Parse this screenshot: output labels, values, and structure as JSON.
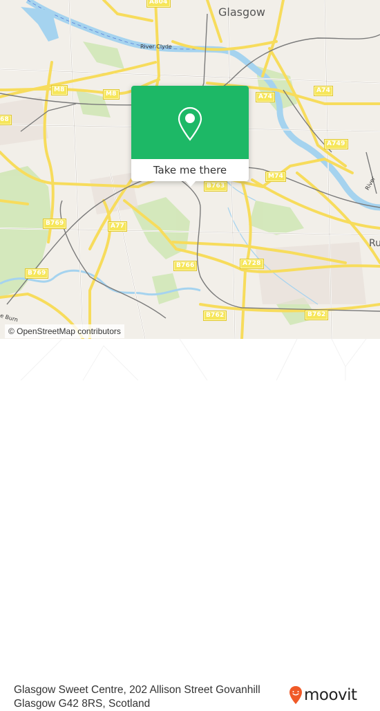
{
  "map": {
    "city_label": "Glasgow",
    "partial_label": "Ru",
    "rivers": [
      "River Clyde",
      "River"
    ],
    "water_label": "e Burn",
    "road_shields": [
      "A804",
      "M8",
      "M8",
      "A74",
      "A74",
      "A749",
      "M74",
      "B763",
      "B769",
      "A77",
      "B769",
      "B766",
      "A728",
      "B762",
      "B762",
      "68"
    ],
    "attribution": "© OpenStreetMap contributors"
  },
  "popup": {
    "icon": "location-pin-icon",
    "button_label": "Take me there",
    "accent_color": "#1db866"
  },
  "footer": {
    "address": "Glasgow Sweet Centre, 202 Allison Street Govanhill Glasgow G42 8RS, Scotland",
    "logo_text": "moovit",
    "logo_color": "#f05a28"
  }
}
